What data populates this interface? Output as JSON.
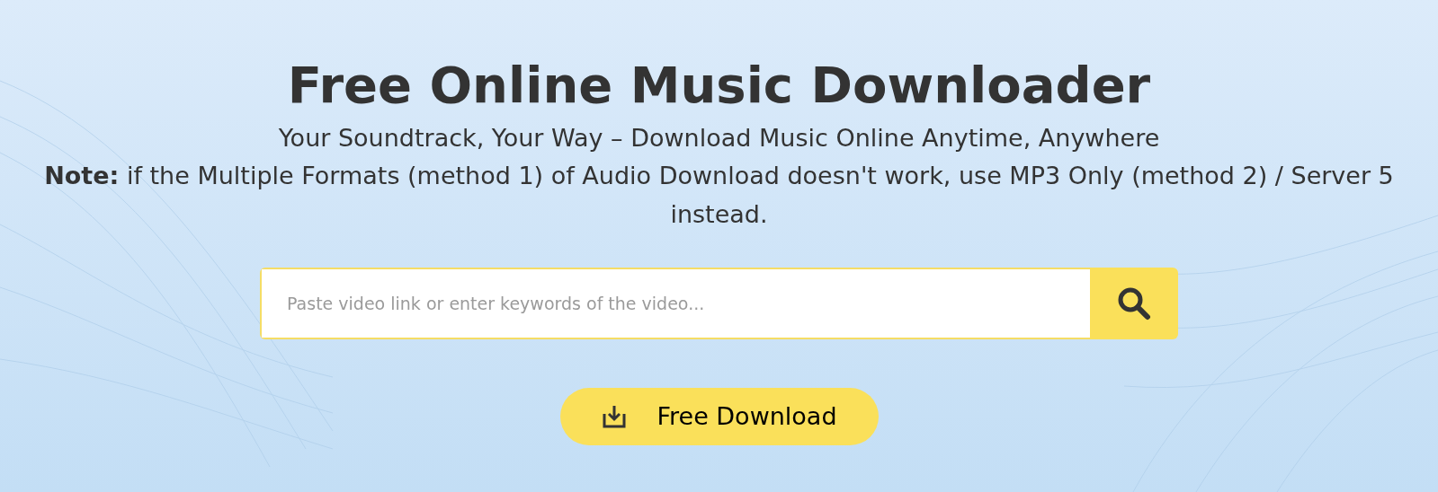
{
  "title": "Free Online Music Downloader",
  "subtitle": "Your Soundtrack, Your Way – Download Music Online Anytime, Anywhere",
  "note": "**Note:** if the Multiple Formats (method 1) of Audio Download doesn't work, use MP3 Only (method 2) / Server 5 instead.",
  "search": {
    "placeholder": "Paste video link or enter keywords of the video..."
  },
  "download_button": {
    "label": "Free Download"
  }
}
